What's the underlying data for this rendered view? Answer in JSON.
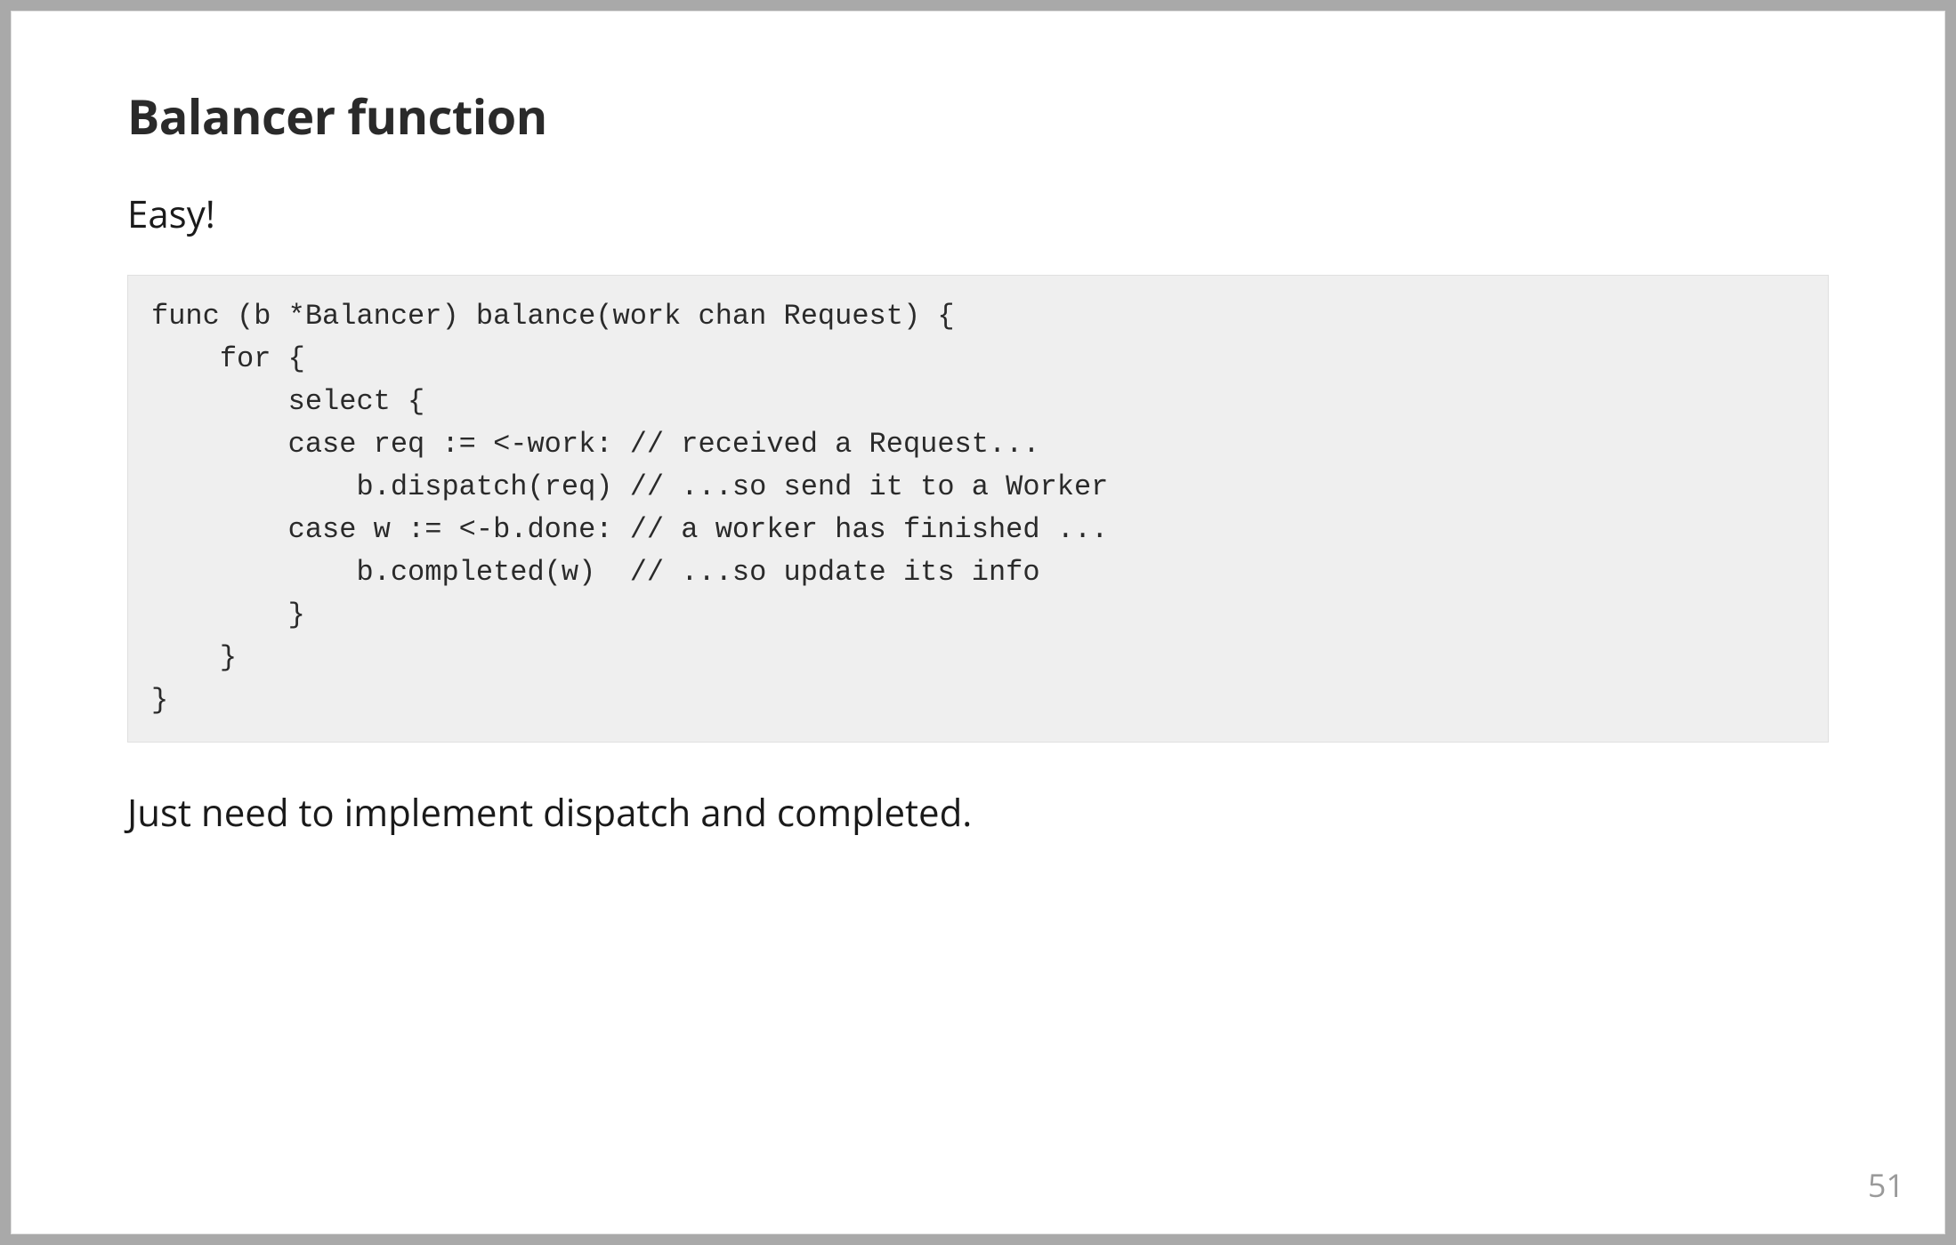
{
  "slide": {
    "title": "Balancer function",
    "subtitle": "Easy!",
    "code": "func (b *Balancer) balance(work chan Request) {\n    for {\n        select {\n        case req := <-work: // received a Request...\n            b.dispatch(req) // ...so send it to a Worker\n        case w := <-b.done: // a worker has finished ...\n            b.completed(w)  // ...so update its info\n        }\n    }\n}",
    "footer_text": "Just need to implement dispatch and completed.",
    "page_number": "51"
  }
}
